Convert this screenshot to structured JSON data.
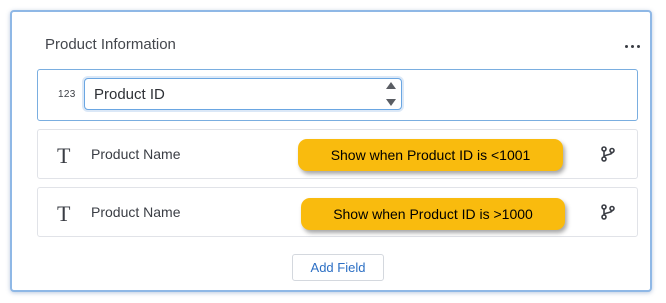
{
  "section": {
    "title": "Product Information",
    "more_icon": "more-horizontal-icon"
  },
  "fields": [
    {
      "type_icon": "123",
      "type_icon_name": "number-type-icon",
      "label": "Product ID",
      "value": "Product ID"
    },
    {
      "type_icon": "T",
      "type_icon_name": "text-type-icon",
      "label": "Product Name",
      "action_icon": "branch-logic-icon"
    },
    {
      "type_icon": "T",
      "type_icon_name": "text-type-icon",
      "label": "Product Name",
      "action_icon": "branch-logic-icon"
    }
  ],
  "annotations": [
    {
      "text": "Show when Product ID is <1001",
      "color": "#f9bb0e"
    },
    {
      "text": "Show when Product ID is >1000",
      "color": "#f9bb0e"
    }
  ],
  "actions": {
    "add_field_label": "Add Field"
  },
  "colors": {
    "accent": "#2c6fc4",
    "focus_border": "#7aaee0",
    "panel_border": "#8fb8e6"
  }
}
